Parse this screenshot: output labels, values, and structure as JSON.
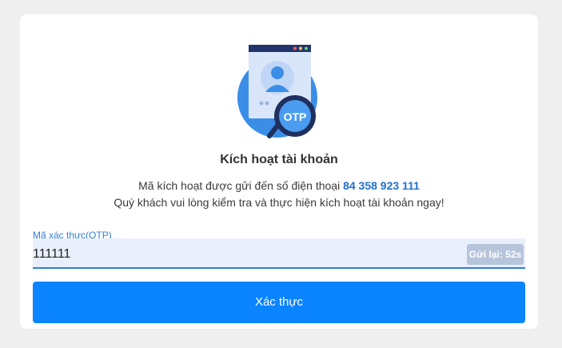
{
  "card": {
    "illustration": {
      "icon": "otp-magnifier-illustration",
      "badge_text": "OTP"
    },
    "title": "Kích hoạt tài khoản",
    "description": {
      "line1_prefix": "Mã kích hoạt được gửi đến số điện thoại",
      "phone": "84 358 923 111",
      "line2": "Quý khách vui lòng kiểm tra và thực hiện kích hoạt tài khoản ngay!"
    },
    "otp": {
      "label": "Mã xác thực(OTP)",
      "value": "111111",
      "resend_label": "Gửi lại: 52s"
    },
    "verify_label": "Xác thực"
  },
  "colors": {
    "page_background": "#efefef",
    "accent": "#0a84ff",
    "phone_link": "#1f6fd0",
    "field_background": "#e8effb",
    "resend_background": "#b6c5db"
  }
}
